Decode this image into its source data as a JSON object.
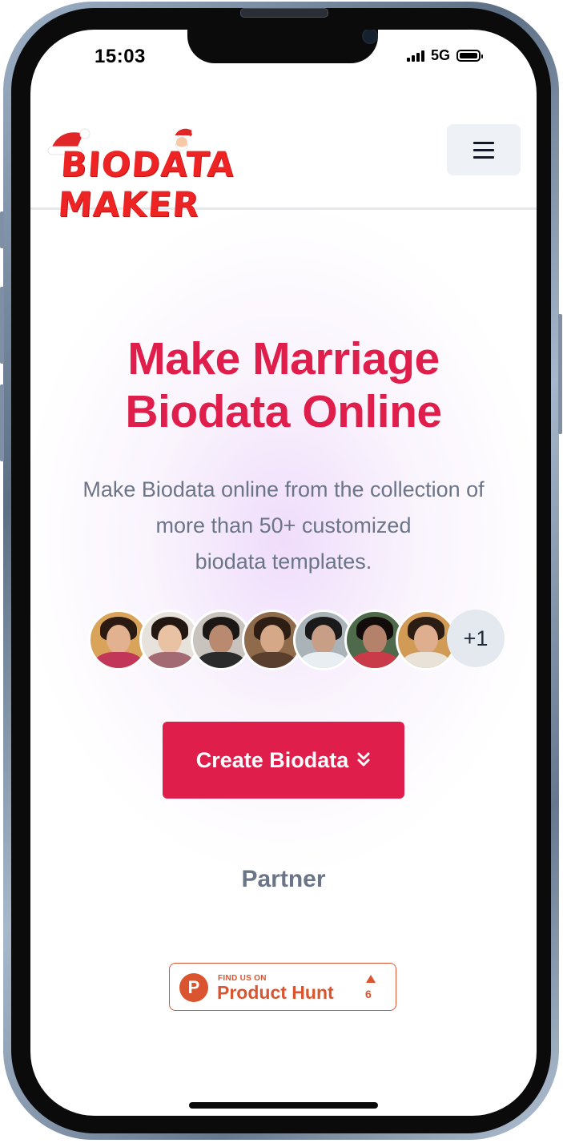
{
  "status_bar": {
    "time": "15:03",
    "network": "5G"
  },
  "header": {
    "logo_text": "BIODATA MAKER"
  },
  "hero": {
    "title_line1": "Make Marriage",
    "title_line2": "Biodata Online",
    "desc_line1": "Make Biodata online from the collection of",
    "desc_line2": "more than 50+ customized",
    "desc_line3": "biodata templates.",
    "avatars_more": "+1",
    "cta_label": "Create Biodata"
  },
  "partner": {
    "title": "Partner",
    "badge_small": "FIND US ON",
    "badge_name": "Product Hunt",
    "badge_logo_letter": "P",
    "badge_count": "6"
  },
  "colors": {
    "accent": "#e01e4b",
    "logo_red": "#ee2424",
    "text_muted": "#6b7588",
    "product_hunt": "#da552f"
  },
  "icons": {
    "menu": "hamburger-icon",
    "cta": "chevrons-down-icon",
    "upvote": "triangle-up-icon"
  }
}
